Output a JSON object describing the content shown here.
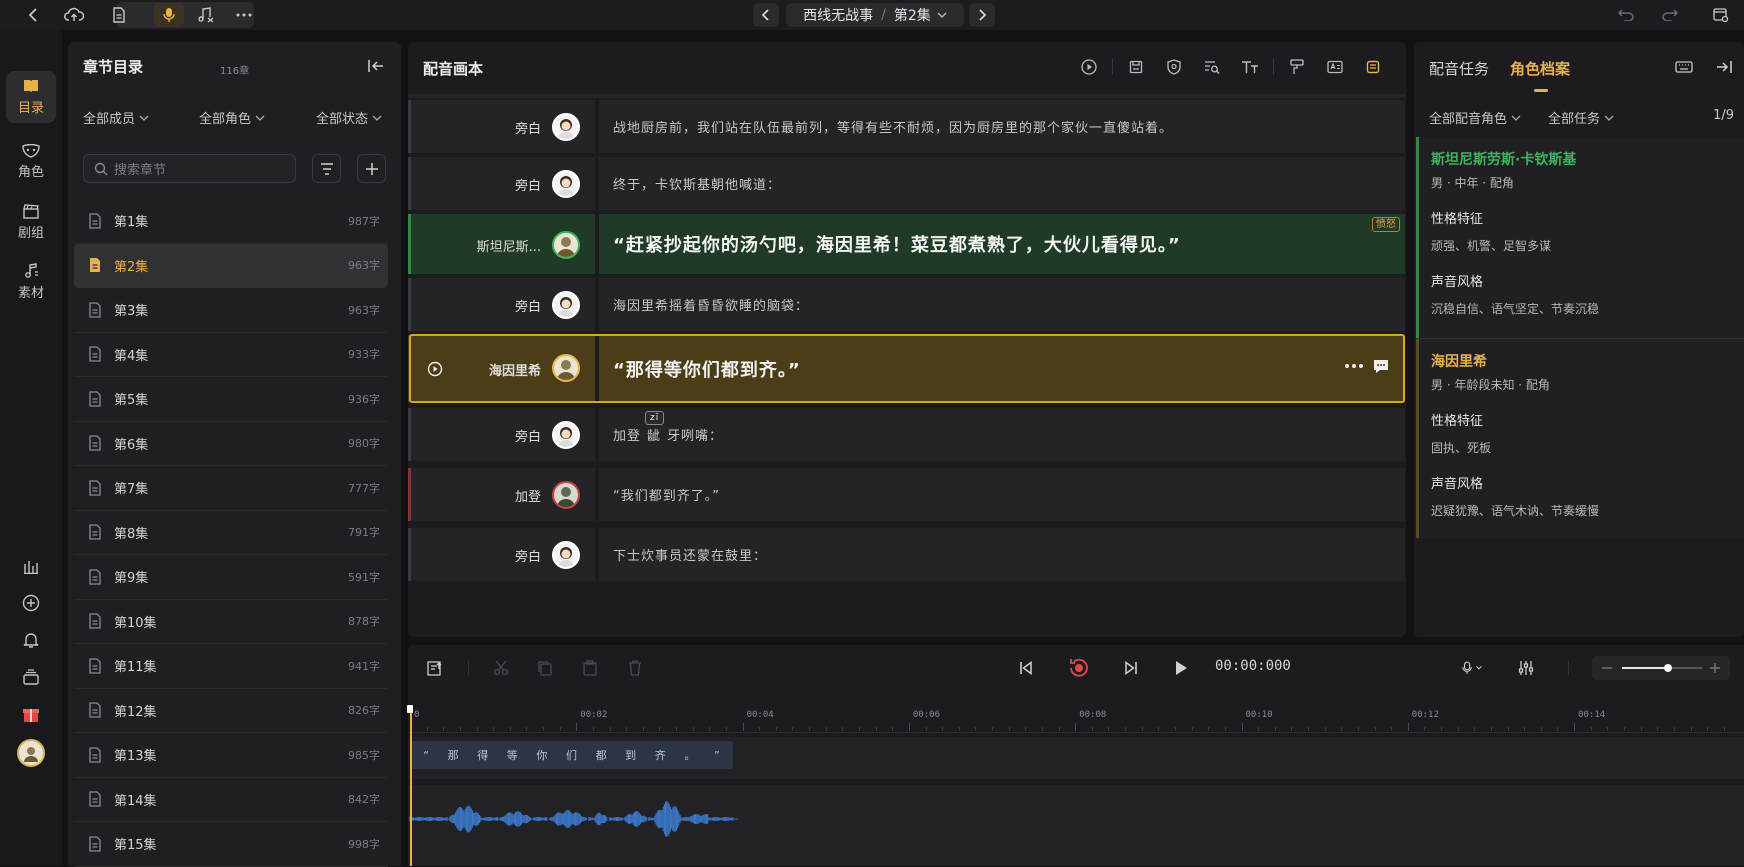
{
  "topbar": {
    "project": "西线无战事",
    "episode": "第2集",
    "separator": "/"
  },
  "leftnav": {
    "items": [
      {
        "label": "目录",
        "icon": "book-icon",
        "active": true
      },
      {
        "label": "角色",
        "icon": "mask-icon"
      },
      {
        "label": "剧组",
        "icon": "clapper-icon"
      },
      {
        "label": "素材",
        "icon": "music-note-icon"
      }
    ]
  },
  "chapters": {
    "title": "章节目录",
    "count": "116章",
    "filters": [
      "全部成员",
      "全部角色",
      "全部状态"
    ],
    "search_placeholder": "搜索章节",
    "items": [
      {
        "name": "第1集",
        "words": "987字"
      },
      {
        "name": "第2集",
        "words": "963字",
        "active": true
      },
      {
        "name": "第3集",
        "words": "963字"
      },
      {
        "name": "第4集",
        "words": "933字"
      },
      {
        "name": "第5集",
        "words": "936字"
      },
      {
        "name": "第6集",
        "words": "980字"
      },
      {
        "name": "第7集",
        "words": "777字"
      },
      {
        "name": "第8集",
        "words": "791字"
      },
      {
        "name": "第9集",
        "words": "591字"
      },
      {
        "name": "第10集",
        "words": "878字"
      },
      {
        "name": "第11集",
        "words": "941字"
      },
      {
        "name": "第12集",
        "words": "826字"
      },
      {
        "name": "第13集",
        "words": "985字"
      },
      {
        "name": "第14集",
        "words": "842字"
      },
      {
        "name": "第15集",
        "words": "998字"
      }
    ]
  },
  "script": {
    "title": "配音画本",
    "rows": [
      {
        "role": "旁白",
        "text": "战地厨房前，我们站在队伍最前列，等得有些不耐烦，因为厨房里的那个家伙一直傻站着。"
      },
      {
        "role": "旁白",
        "text": "终于，卡钦斯基朝他喊道："
      },
      {
        "role": "斯坦尼斯...",
        "text": "“赶紧抄起你的汤勺吧，海因里希！菜豆都煮熟了，大伙儿看得见。”",
        "tag": "愤怒"
      },
      {
        "role": "旁白",
        "text": "海因里希摇着昏昏欲睡的脑袋："
      },
      {
        "role": "海因里希",
        "text": "“那得等你们都到齐。”"
      },
      {
        "role": "旁白",
        "text_parts": [
          "加登",
          "龇",
          "牙咧嘴："
        ],
        "pinyin": "zī"
      },
      {
        "role": "加登",
        "text": "“我们都到齐了。”"
      },
      {
        "role": "旁白",
        "text": "下士炊事员还蒙在鼓里："
      }
    ]
  },
  "right": {
    "tabs": [
      "配音任务",
      "角色档案"
    ],
    "filters": [
      "全部配音角色",
      "全部任务"
    ],
    "page": "1/9",
    "cards": [
      {
        "name": "斯坦尼斯劳斯·卡钦斯基",
        "color": "#3fb35a",
        "meta": "男 · 中年 · 配角",
        "trait_label": "性格特征",
        "traits": "顽强、机警、足智多谋",
        "voice_label": "声音风格",
        "voice": "沉稳自信、语气坚定、节奏沉稳"
      },
      {
        "name": "海因里希",
        "color": "#e8b24a",
        "meta": "男 · 年龄段未知 · 配角",
        "trait_label": "性格特征",
        "traits": "固执、死板",
        "voice_label": "声音风格",
        "voice": "迟疑犹豫、语气木讷、节奏缓慢"
      }
    ]
  },
  "timeline": {
    "time": "00:00:000",
    "ruler": [
      "0",
      "00:02",
      "00:04",
      "00:06",
      "00:08",
      "00:10",
      "00:12",
      "00:14"
    ],
    "clip_chars": [
      "“",
      "那",
      "得",
      "等",
      "你",
      "们",
      "都",
      "到",
      "齐",
      "。",
      "”"
    ]
  },
  "colors": {
    "accent": "#e8b24a",
    "green": "#2f8a45",
    "wave": "#3d7fd6"
  }
}
